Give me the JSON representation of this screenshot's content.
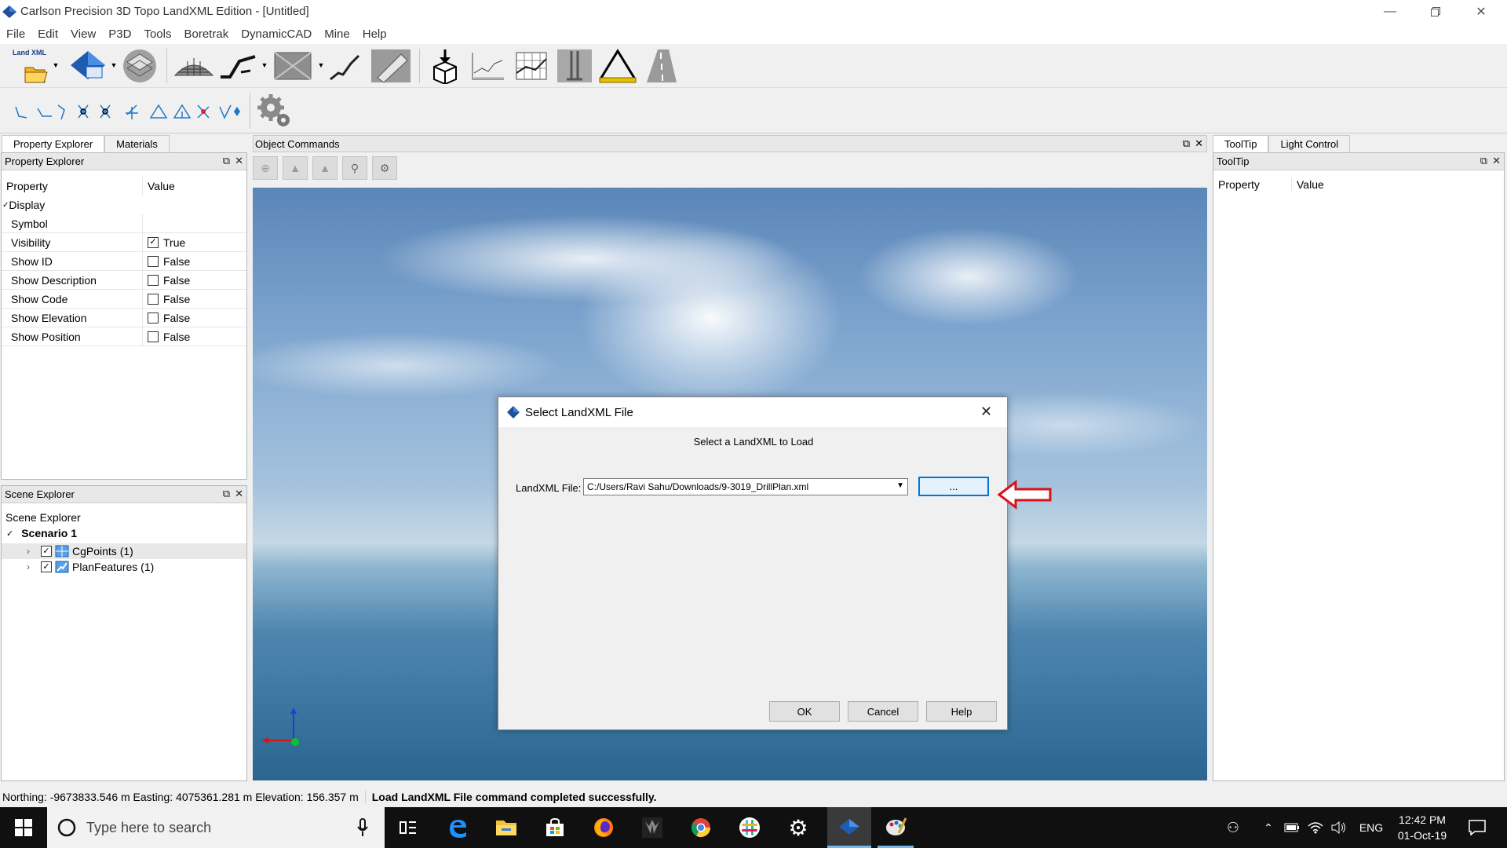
{
  "window": {
    "title": "Carlson Precision 3D Topo LandXML Edition - [Untitled]"
  },
  "menu": [
    "File",
    "Edit",
    "View",
    "P3D",
    "Tools",
    "Boretrak",
    "DynamicCAD",
    "Mine",
    "Help"
  ],
  "toolbar": {
    "landxml_label": "Land XML"
  },
  "left_tabs": {
    "property_explorer": "Property Explorer",
    "materials": "Materials"
  },
  "property_explorer": {
    "header": "Property Explorer",
    "col_property": "Property",
    "col_value": "Value",
    "group": "Display",
    "rows": [
      {
        "name": "Symbol",
        "value": "",
        "checked": null
      },
      {
        "name": "Visibility",
        "value": "True",
        "checked": true
      },
      {
        "name": "Show ID",
        "value": "False",
        "checked": false
      },
      {
        "name": "Show Description",
        "value": "False",
        "checked": false
      },
      {
        "name": "Show Code",
        "value": "False",
        "checked": false
      },
      {
        "name": "Show Elevation",
        "value": "False",
        "checked": false
      },
      {
        "name": "Show Position",
        "value": "False",
        "checked": false
      }
    ]
  },
  "scene_explorer": {
    "header": "Scene Explorer",
    "title": "Scene Explorer",
    "root": "Scenario 1",
    "items": [
      "CgPoints (1)",
      "PlanFeatures (1)"
    ]
  },
  "object_commands": {
    "header": "Object Commands"
  },
  "right_tabs": {
    "tooltip": "ToolTip",
    "light_control": "Light Control"
  },
  "tooltip_panel": {
    "header": "ToolTip",
    "col_property": "Property",
    "col_value": "Value"
  },
  "dialog": {
    "title": "Select LandXML File",
    "prompt": "Select a LandXML to Load",
    "file_label": "LandXML File:",
    "file_value": "C:/Users/Ravi Sahu/Downloads/9-3019_DrillPlan.xml",
    "browse_label": "...",
    "ok": "OK",
    "cancel": "Cancel",
    "help": "Help"
  },
  "status": {
    "coords": "Northing: -9673833.546 m Easting: 4075361.281 m Elevation: 156.357 m",
    "message": "Load LandXML File command completed successfully."
  },
  "taskbar": {
    "search_placeholder": "Type here to search",
    "lang": "ENG",
    "time": "12:42 PM",
    "date": "01-Oct-19"
  },
  "colors": {
    "accent_arrow": "#d9111a",
    "dialog_focus": "#0078d7",
    "taskbar": "#101010"
  }
}
